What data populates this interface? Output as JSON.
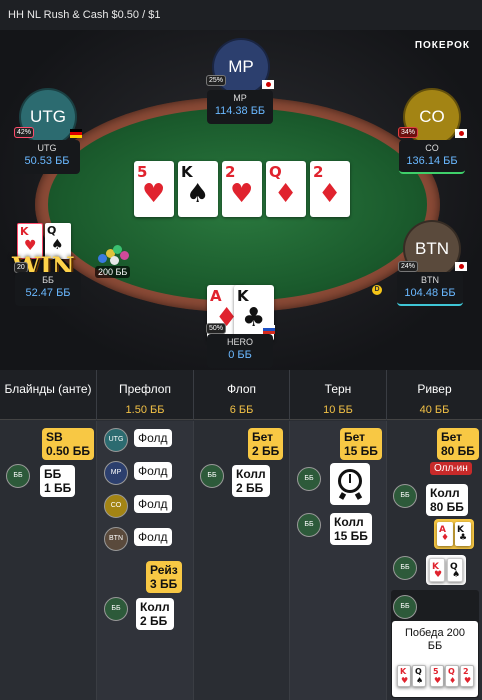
{
  "header": {
    "title": "HH NL Rush & Cash $0.50 / $1",
    "brand": "ПОКЕРОК"
  },
  "table": {
    "seats": {
      "mp": {
        "avatar": "MP",
        "name": "MP",
        "stack": "114.38 ББ",
        "pct": "25%"
      },
      "utg": {
        "avatar": "UTG",
        "name": "UTG",
        "stack": "50.53 ББ",
        "pct": "42%"
      },
      "co": {
        "avatar": "CO",
        "name": "CO",
        "stack": "136.14 ББ",
        "pct": "34%"
      },
      "bb": {
        "name": "ББ",
        "stack": "52.47 ББ",
        "pct": "20"
      },
      "btn": {
        "avatar": "BTN",
        "name": "BTN",
        "stack": "104.48 ББ",
        "pct": "24%"
      },
      "hero": {
        "name": "HERO",
        "stack": "0 ББ",
        "pct": "50%"
      }
    },
    "board": [
      {
        "rank": "5",
        "suit": "♥"
      },
      {
        "rank": "K",
        "suit": "♠"
      },
      {
        "rank": "2",
        "suit": "♥"
      },
      {
        "rank": "Q",
        "suit": "♦"
      },
      {
        "rank": "2",
        "suit": "♦"
      }
    ],
    "bb_cards": [
      {
        "rank": "K",
        "suit": "♥"
      },
      {
        "rank": "Q",
        "suit": "♠"
      }
    ],
    "hero_cards": [
      {
        "rank": "A",
        "suit": "♦"
      },
      {
        "rank": "K",
        "suit": "♣"
      }
    ],
    "win_label": "WIN",
    "pot": "200 ББ",
    "dealer": "D"
  },
  "streets": [
    {
      "label": "Блайнды (анте)",
      "amount": ""
    },
    {
      "label": "Префлоп",
      "amount": "1.50 ББ"
    },
    {
      "label": "Флоп",
      "amount": "6 ББ"
    },
    {
      "label": "Терн",
      "amount": "10 ББ"
    },
    {
      "label": "Ривер",
      "amount": "40 ББ"
    }
  ],
  "actions": {
    "blinds": {
      "sb": "SB\n0.50 ББ",
      "bb_badge": "ББ",
      "bb": "ББ\n1 ББ"
    },
    "preflop": {
      "utg_badge": "UTG",
      "utg": "Фолд",
      "mp_badge": "MP",
      "mp": "Фолд",
      "co_badge": "CO",
      "co": "Фолд",
      "btn_badge": "BTN",
      "btn": "Фолд",
      "raise": "Рейз\n3 ББ",
      "bb_badge": "ББ",
      "bb": "Колл\n2 ББ"
    },
    "flop": {
      "bet": "Бет\n2 ББ",
      "bb_badge": "ББ",
      "bb": "Колл\n2 ББ"
    },
    "turn": {
      "bet": "Бет\n15 ББ",
      "bb_badge": "ББ",
      "bb": "Колл\n15 ББ",
      "timer_icon": "alarm-clock-icon"
    },
    "river": {
      "bet": "Бет\n80 ББ",
      "allin": "Олл-ин",
      "bb_badge": "ББ",
      "bb": "Колл\n80 ББ",
      "hero_show": [
        {
          "rank": "A",
          "suit": "♦"
        },
        {
          "rank": "K",
          "suit": "♣"
        }
      ],
      "bb_badge2": "ББ",
      "bb_show": [
        {
          "rank": "K",
          "suit": "♥"
        },
        {
          "rank": "Q",
          "suit": "♠"
        }
      ],
      "bb_badge3": "ББ",
      "win_text": "Победа 200\nББ",
      "win_cards": [
        {
          "rank": "K",
          "suit": "♥"
        },
        {
          "rank": "Q",
          "suit": "♠"
        },
        {
          "rank": "5",
          "suit": "♥"
        },
        {
          "rank": "Q",
          "suit": "♦"
        },
        {
          "rank": "2",
          "suit": "♥"
        }
      ]
    }
  },
  "colors": {
    "accent_gold": "#f8c844",
    "stack_blue": "#6ab8ff",
    "felt_green": "#1a5a2c",
    "co_ring": "#e7c23a",
    "btn_ring": "#3fc6d6",
    "bb_ring": "#ff4d6d",
    "utg_ring": "#ff4d6d"
  }
}
